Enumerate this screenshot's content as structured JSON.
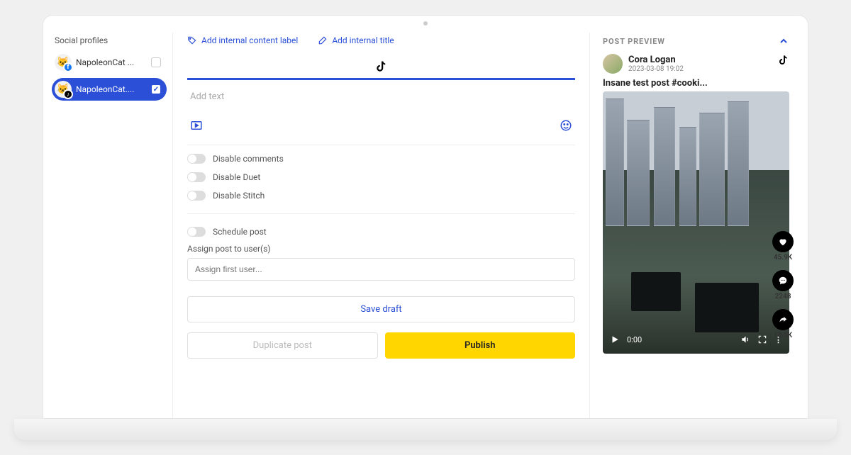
{
  "sidebar": {
    "title": "Social profiles",
    "profiles": [
      {
        "label": "NapoleonCat ...",
        "network": "fb",
        "selected": false
      },
      {
        "label": "NapoleonCat....",
        "network": "tt",
        "selected": true
      }
    ]
  },
  "composer": {
    "add_label_link": "Add internal content label",
    "add_title_link": "Add internal title",
    "text_placeholder": "Add text",
    "toggles": {
      "disable_comments": "Disable comments",
      "disable_duet": "Disable Duet",
      "disable_stitch": "Disable Stitch",
      "schedule_post": "Schedule post"
    },
    "assign": {
      "label": "Assign post to user(s)",
      "placeholder": "Assign first user..."
    },
    "buttons": {
      "save_draft": "Save draft",
      "duplicate": "Duplicate post",
      "publish": "Publish"
    }
  },
  "preview": {
    "header": "POST PREVIEW",
    "user_name": "Cora Logan",
    "timestamp": "2023-03-08 19:02",
    "caption": "Insane test post #cooki...",
    "video_time": "0:00",
    "engagement": {
      "likes": "45.9K",
      "comments": "2248",
      "shares": "10.8K"
    }
  }
}
